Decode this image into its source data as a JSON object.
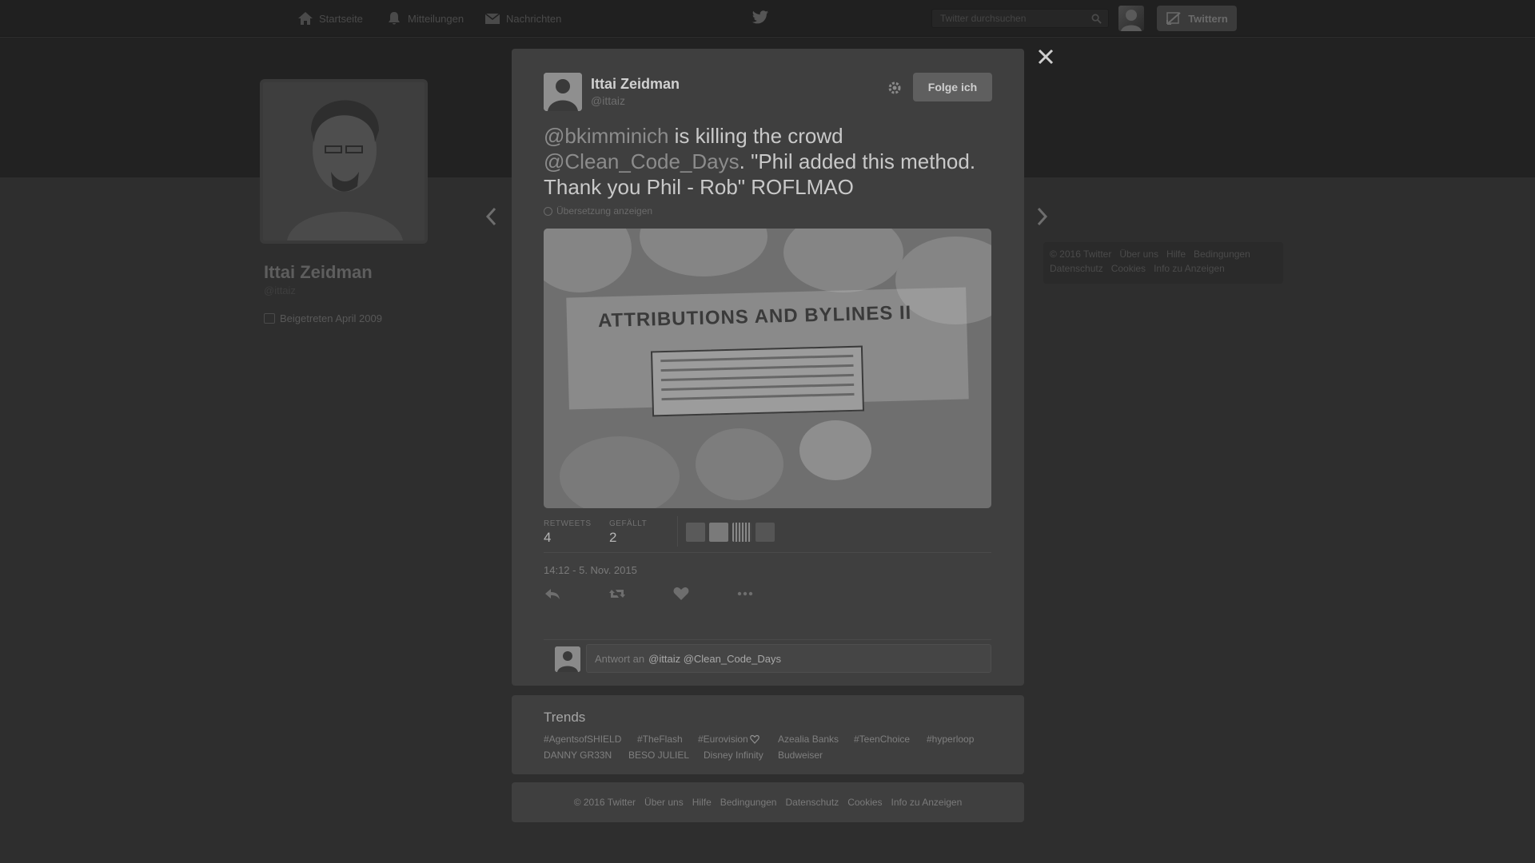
{
  "nav": {
    "home": "Startseite",
    "notifications": "Mitteilungen",
    "messages": "Nachrichten",
    "search_placeholder": "Twitter durchsuchen",
    "tweet_button": "Twittern"
  },
  "profile": {
    "name": "Ittai Zeidman",
    "handle": "@ittaiz",
    "joined": "Beigetreten April 2009"
  },
  "side_footer": [
    "© 2016 Twitter",
    "Über uns",
    "Hilfe",
    "Bedingungen",
    "Datenschutz",
    "Cookies",
    "Info zu Anzeigen"
  ],
  "tweet": {
    "author_name": "Ittai Zeidman",
    "author_handle": "@ittaiz",
    "follow_button": "Folge ich",
    "text_parts": {
      "m1": "@bkimminich",
      "t1": " is killing the crowd ",
      "m2": "@Clean_Code_Days",
      "t2": ". \"Phil added this method. Thank you Phil - Rob\" ROFLMAO"
    },
    "translate": "Übersetzung anzeigen",
    "media": {
      "slide_title": "ATTRIBUTIONS AND BYLINES II"
    },
    "retweets_label": "RETWEETS",
    "retweets": "4",
    "likes_label": "GEFÄLLT",
    "likes": "2",
    "timestamp": "14:12 - 5. Nov. 2015",
    "reply_prefix": "Antwort an",
    "reply_mentions": "@ittaiz @Clean_Code_Days"
  },
  "trends": {
    "title": "Trends",
    "items": [
      "#AgentsofSHIELD",
      "#TheFlash",
      "#Eurovision",
      "Azealia Banks",
      "#TeenChoice",
      "#hyperloop",
      "DANNY GR33N",
      "BESO JULIEL",
      "Disney Infinity",
      "Budweiser"
    ]
  },
  "footer": [
    "© 2016 Twitter",
    "Über uns",
    "Hilfe",
    "Bedingungen",
    "Datenschutz",
    "Cookies",
    "Info zu Anzeigen"
  ],
  "colors": {
    "overlay": "#2e2e2e",
    "modal": "#3f3f3f",
    "follow_button": "#5f5f5f"
  }
}
